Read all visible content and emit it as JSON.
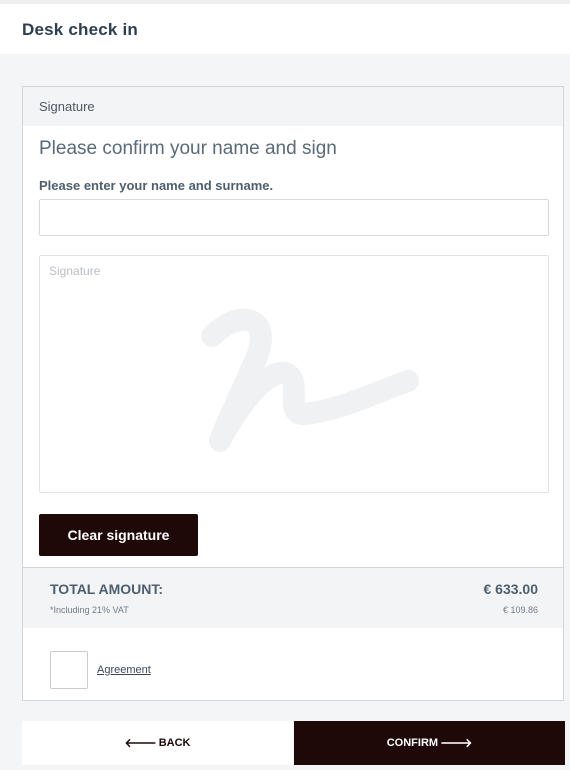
{
  "header": {
    "title": "Desk check in"
  },
  "card": {
    "section_label": "Signature",
    "prompt": "Please confirm your name and sign",
    "name_field": {
      "label": "Please enter your name and surname.",
      "value": "",
      "placeholder": ""
    },
    "signature_pad": {
      "placeholder": "Signature"
    },
    "clear_button_label": "Clear signature"
  },
  "totals": {
    "total_label": "TOTAL AMOUNT:",
    "total_value": "€ 633.00",
    "vat_label": "*Including 21% VAT",
    "vat_value": "€ 109.86"
  },
  "agreement": {
    "checked": false,
    "link_label": "Agreement"
  },
  "footer": {
    "back_label": "BACK",
    "confirm_label": "CONFIRM"
  },
  "colors": {
    "primary_dark": "#1e0808",
    "text_slate": "#4d5f6e",
    "panel_bg": "#f3f4f6"
  },
  "icons": {
    "back": "arrow-left-icon",
    "confirm": "arrow-right-icon",
    "signature_watermark": "signature-icon"
  }
}
